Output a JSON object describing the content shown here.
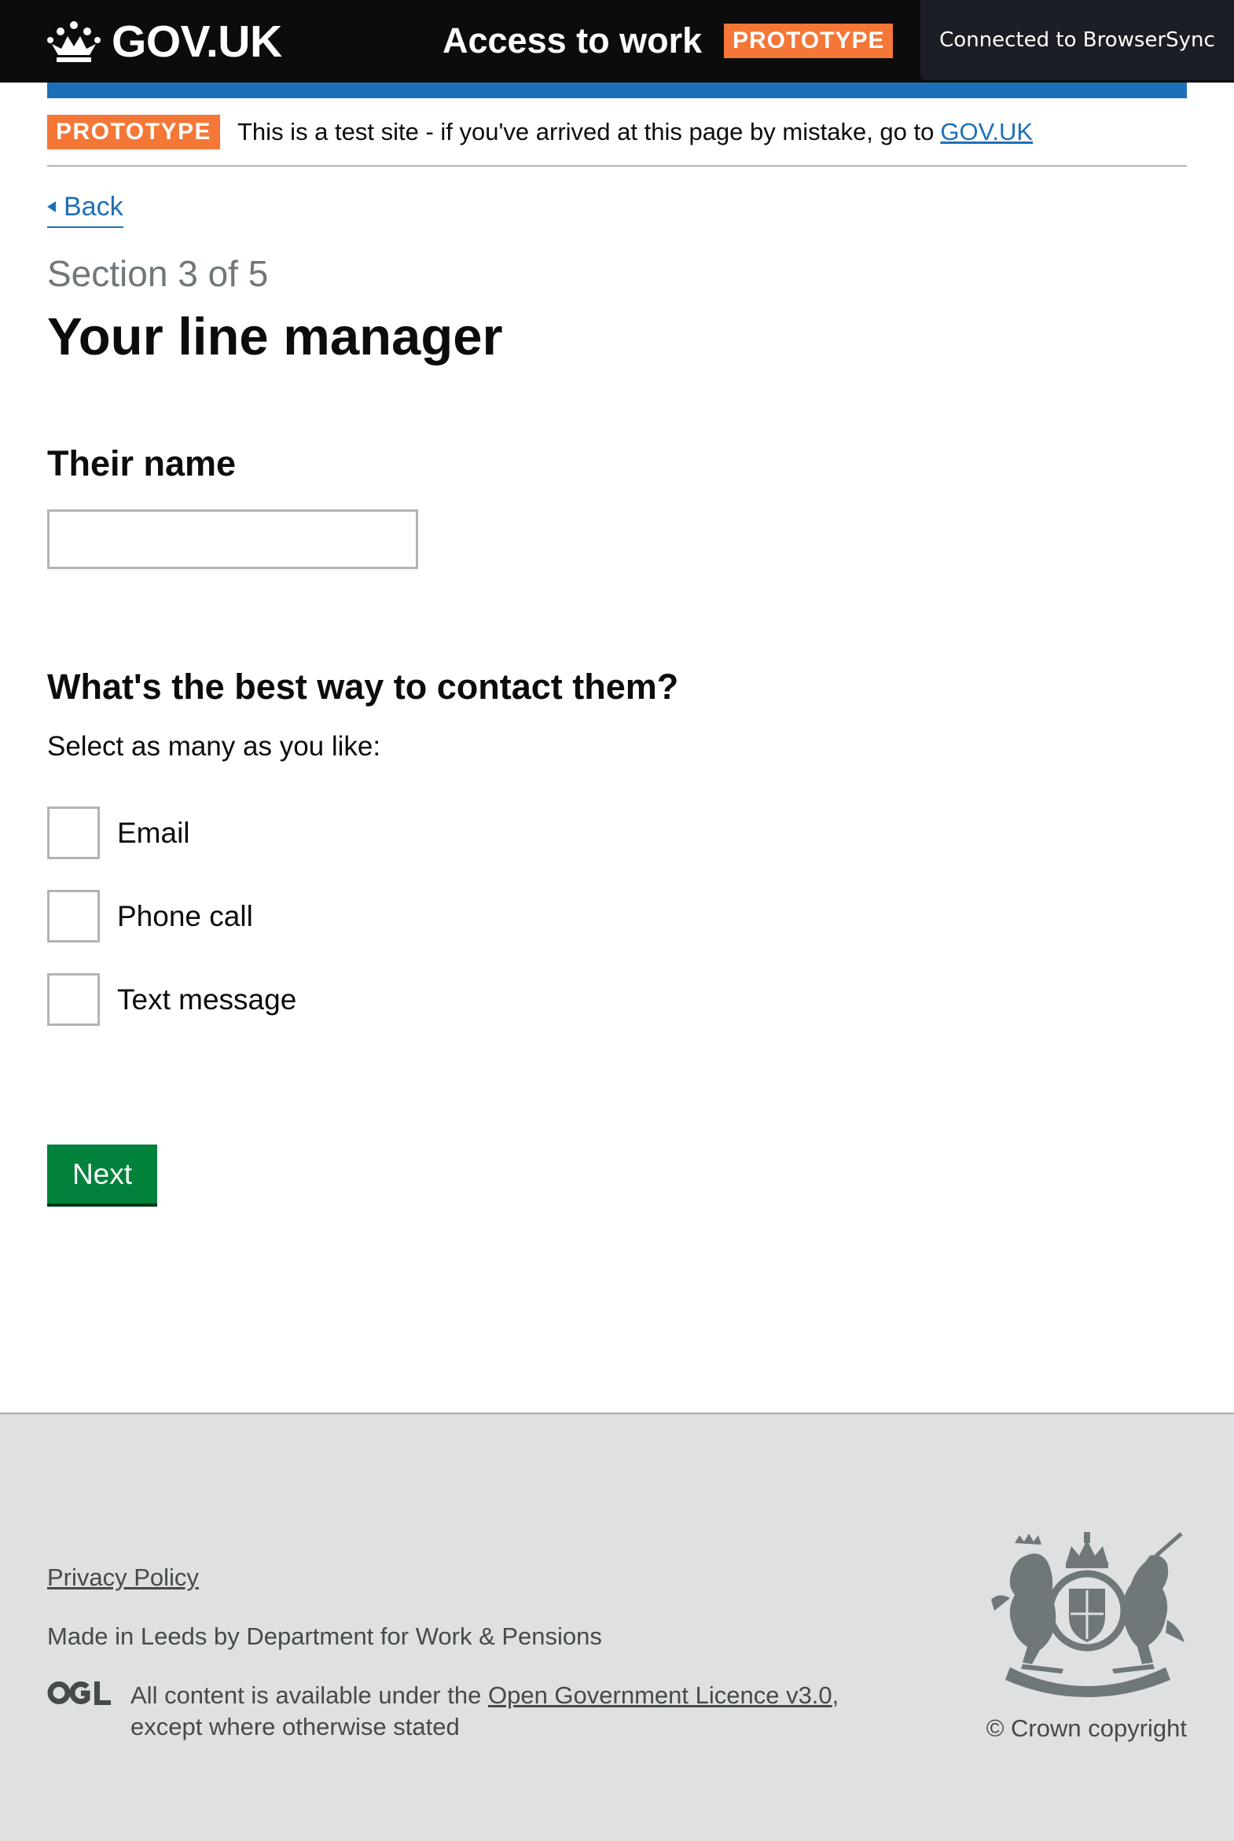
{
  "header": {
    "logo_text": "GOV.UK",
    "service_name": "Access to work",
    "phase_tag": "PROTOTYPE",
    "browsersync_notice": "Connected to BrowserSync"
  },
  "phase_banner": {
    "tag": "PROTOTYPE",
    "text": "This is a test site - if you've arrived at this page by mistake, go to",
    "link_text": "GOV.UK"
  },
  "main": {
    "back_label": "Back",
    "caption": "Section 3 of 5",
    "title": "Your line manager",
    "name_field": {
      "label": "Their name",
      "value": "",
      "placeholder": ""
    },
    "contact": {
      "legend": "What's the best way to contact them?",
      "hint": "Select as many as you like:",
      "options": [
        {
          "label": "Email",
          "checked": false
        },
        {
          "label": "Phone call",
          "checked": false
        },
        {
          "label": "Text message",
          "checked": false
        }
      ]
    },
    "next_label": "Next"
  },
  "footer": {
    "privacy_link": "Privacy Policy",
    "made_by": "Made in Leeds by Department for Work & Pensions",
    "licence_prefix": "All content is available under the",
    "licence_link": "Open Government Licence v3.0",
    "licence_suffix": ", except where otherwise stated",
    "copyright": "© Crown copyright",
    "ogl_logo": "ogl-logo-icon",
    "crest": "royal-coat-of-arms-icon"
  },
  "colors": {
    "header_bg": "#0b0c0c",
    "brand_blue": "#1d70b8",
    "phase_orange": "#f47738",
    "button_green": "#00823b",
    "footer_bg": "#dee0e2",
    "caption_grey": "#6f777b"
  }
}
